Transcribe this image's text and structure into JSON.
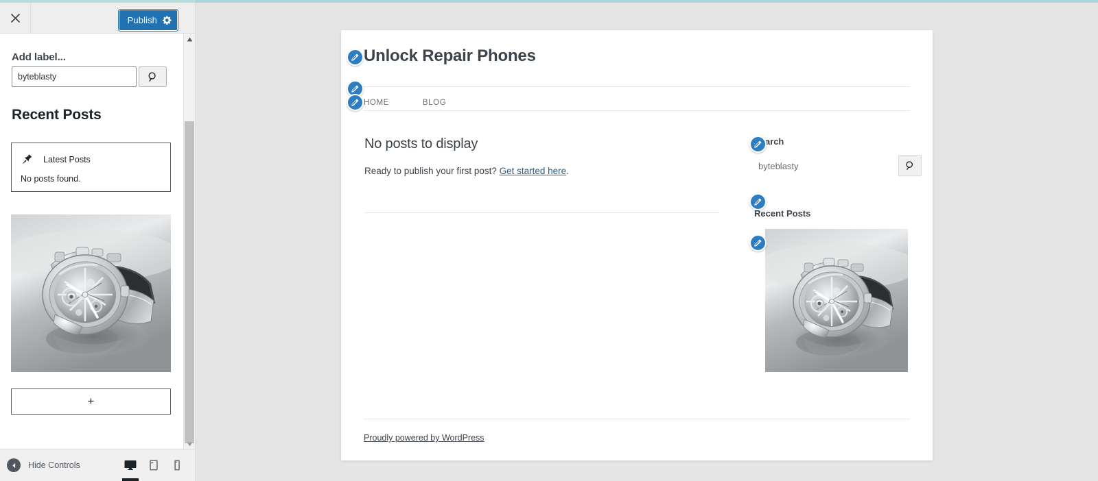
{
  "customizer": {
    "close_icon": "close-icon",
    "publish": {
      "label": "Publish",
      "gear_icon": "gear-icon"
    },
    "section_label": "Add label...",
    "label_input_value": "byteblasty",
    "label_search_icon": "search-icon",
    "heading": "Recent Posts",
    "latest_posts_block": {
      "pin_icon": "pin-icon",
      "title": "Latest Posts",
      "empty_text": "No posts found."
    },
    "image_block_alt": "grayscale skeleton wristwatch photo",
    "add_block_label": "+",
    "footer": {
      "hide_controls_label": "Hide Controls",
      "back_icon": "chevron-left-icon",
      "devices": [
        {
          "name": "desktop",
          "icon": "desktop-icon",
          "active": true
        },
        {
          "name": "tablet",
          "icon": "tablet-icon",
          "active": false
        },
        {
          "name": "mobile",
          "icon": "mobile-icon",
          "active": false
        }
      ]
    }
  },
  "preview": {
    "site_title": "Unlock Repair Phones",
    "nav": [
      {
        "label": "HOME"
      },
      {
        "label": "BLOG"
      }
    ],
    "main": {
      "no_posts_title": "No posts to display",
      "ready_text": "Ready to publish your first post? ",
      "get_started_link": "Get started here",
      "ready_suffix": "."
    },
    "sidebar": {
      "search_title": "Search",
      "search_value": "byteblasty",
      "search_icon": "search-icon",
      "recent_posts_title": "Recent Posts",
      "image_alt": "grayscale skeleton wristwatch photo"
    },
    "footer_credit": "Proudly powered by WordPress"
  },
  "colors": {
    "accent_blue": "#2271b1",
    "edit_bubble": "#2d7ec1",
    "top_strip": "#a7d7d9",
    "preview_bg": "#e5e5e5",
    "link": "#2b5c8a"
  }
}
